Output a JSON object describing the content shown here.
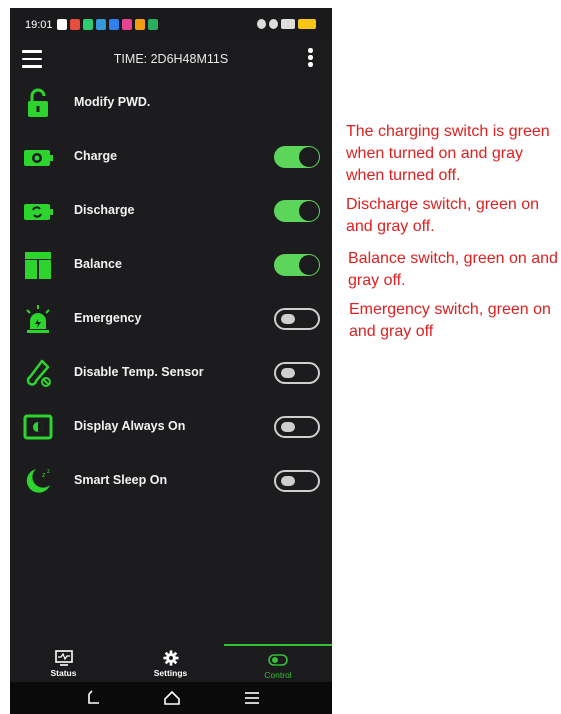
{
  "status_bar": {
    "time": "19:01",
    "notification_colors": [
      "#e74c3c",
      "#2ecc71",
      "#3498db",
      "#2f80ed",
      "#e84393",
      "#f39c12",
      "#27ae60"
    ]
  },
  "app_bar": {
    "title": "TIME: 2D6H48M11S",
    "menu_icon": "hamburger-menu-icon",
    "more_icon": "more-vertical-icon"
  },
  "control_items": [
    {
      "label": "Modify PWD.",
      "icon": "lock-icon",
      "toggle": null
    },
    {
      "label": "Charge",
      "icon": "charge-battery-icon",
      "toggle": "on"
    },
    {
      "label": "Discharge",
      "icon": "discharge-battery-icon",
      "toggle": "on"
    },
    {
      "label": "Balance",
      "icon": "balance-battery-icon",
      "toggle": "on"
    },
    {
      "label": "Emergency",
      "icon": "emergency-siren-icon",
      "toggle": "off"
    },
    {
      "label": "Disable Temp. Sensor",
      "icon": "thermometer-off-icon",
      "toggle": "off"
    },
    {
      "label": "Display Always On",
      "icon": "display-brightness-icon",
      "toggle": "off"
    },
    {
      "label": "Smart Sleep On",
      "icon": "moon-sleep-icon",
      "toggle": "off"
    }
  ],
  "tabs": [
    {
      "label": "Status",
      "icon": "monitor-icon",
      "active": false
    },
    {
      "label": "Settings",
      "icon": "gear-icon",
      "active": false
    },
    {
      "label": "Control",
      "icon": "toggle-icon",
      "active": true
    }
  ],
  "notes": [
    "The charging switch is green when turned on and gray when turned off.",
    "Discharge switch, green on and gray off.",
    "Balance switch, green on and gray off.",
    "Emergency switch, green on and gray off"
  ],
  "colors": {
    "accent_green": "#35c035",
    "toggle_on": "#5bd65b",
    "toggle_off": "#cfcfcf",
    "background": "#1c1c1e",
    "note_red": "#e02020"
  }
}
